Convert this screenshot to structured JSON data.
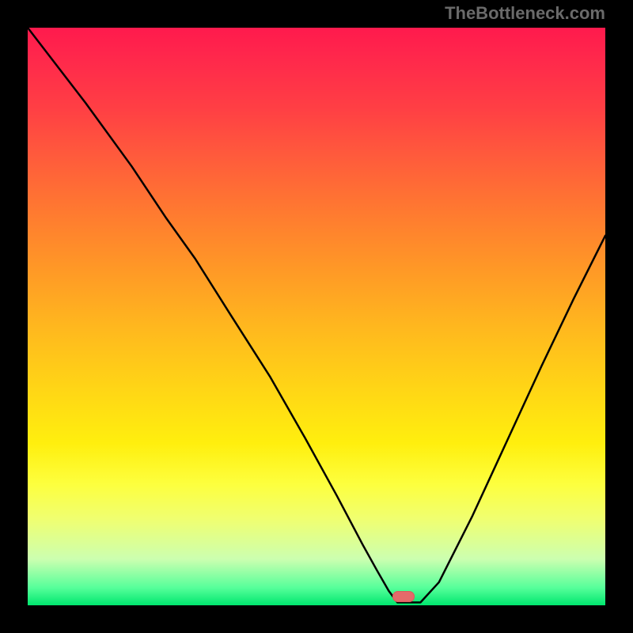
{
  "watermark": "TheBottleneck.com",
  "marker": {
    "center_x": 0.65,
    "y_inside": 0.985
  },
  "chart_data": {
    "type": "line",
    "title": "",
    "xlabel": "",
    "ylabel": "",
    "xlim": [
      0,
      1
    ],
    "ylim": [
      0,
      1
    ],
    "series": [
      {
        "name": "bottleneck-curve",
        "points": [
          {
            "x": 0.0,
            "y": 1.0
          },
          {
            "x": 0.1,
            "y": 0.87
          },
          {
            "x": 0.18,
            "y": 0.76
          },
          {
            "x": 0.24,
            "y": 0.67
          },
          {
            "x": 0.29,
            "y": 0.6
          },
          {
            "x": 0.35,
            "y": 0.505
          },
          {
            "x": 0.42,
            "y": 0.395
          },
          {
            "x": 0.48,
            "y": 0.29
          },
          {
            "x": 0.535,
            "y": 0.19
          },
          {
            "x": 0.58,
            "y": 0.105
          },
          {
            "x": 0.605,
            "y": 0.06
          },
          {
            "x": 0.625,
            "y": 0.025
          },
          {
            "x": 0.64,
            "y": 0.005
          },
          {
            "x": 0.68,
            "y": 0.005
          },
          {
            "x": 0.712,
            "y": 0.04
          },
          {
            "x": 0.77,
            "y": 0.155
          },
          {
            "x": 0.83,
            "y": 0.285
          },
          {
            "x": 0.89,
            "y": 0.415
          },
          {
            "x": 0.945,
            "y": 0.53
          },
          {
            "x": 1.0,
            "y": 0.64
          }
        ]
      }
    ],
    "gradient_top_color": "#ff1a4d",
    "gradient_bottom_color": "#00e66e"
  }
}
